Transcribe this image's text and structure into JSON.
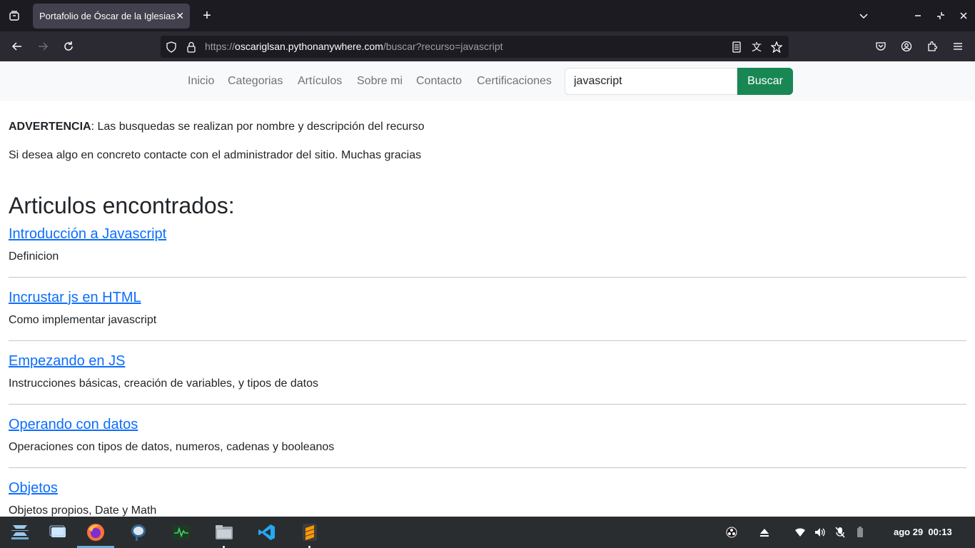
{
  "browser": {
    "tab_title": "Portafolio de Óscar de la Iglesias",
    "url_scheme": "https://",
    "url_host": "oscariglsan.pythonanywhere.com",
    "url_path": "/buscar?recurso=javascript"
  },
  "site_nav": {
    "links": [
      "Inicio",
      "Categorias",
      "Artículos",
      "Sobre mi",
      "Contacto",
      "Certificaciones"
    ],
    "search_value": "javascript",
    "search_button": "Buscar"
  },
  "main": {
    "warning_label": "ADVERTENCIA",
    "warning_text": ": Las busquedas se realizan por nombre y descripción del recurso",
    "contact_text": "Si desea algo en concreto contacte con el administrador del sitio. Muchas gracias",
    "heading": "Articulos encontrados:",
    "articles": [
      {
        "title": "Introducción a Javascript",
        "desc": "Definicion"
      },
      {
        "title": "Incrustar js en HTML",
        "desc": "Como implementar javascript"
      },
      {
        "title": "Empezando en JS",
        "desc": "Instrucciones básicas, creación de variables, y tipos de datos"
      },
      {
        "title": "Operando con datos",
        "desc": "Operaciones con tipos de datos, numeros, cadenas y booleanos"
      },
      {
        "title": "Objetos",
        "desc": "Objetos propios, Date y Math"
      }
    ]
  },
  "taskbar": {
    "clock_date": "ago 29",
    "clock_time": "00:13"
  },
  "colors": {
    "link": "#0d6efd",
    "button_success": "#198754",
    "browser_dark": "#1c1b22"
  }
}
